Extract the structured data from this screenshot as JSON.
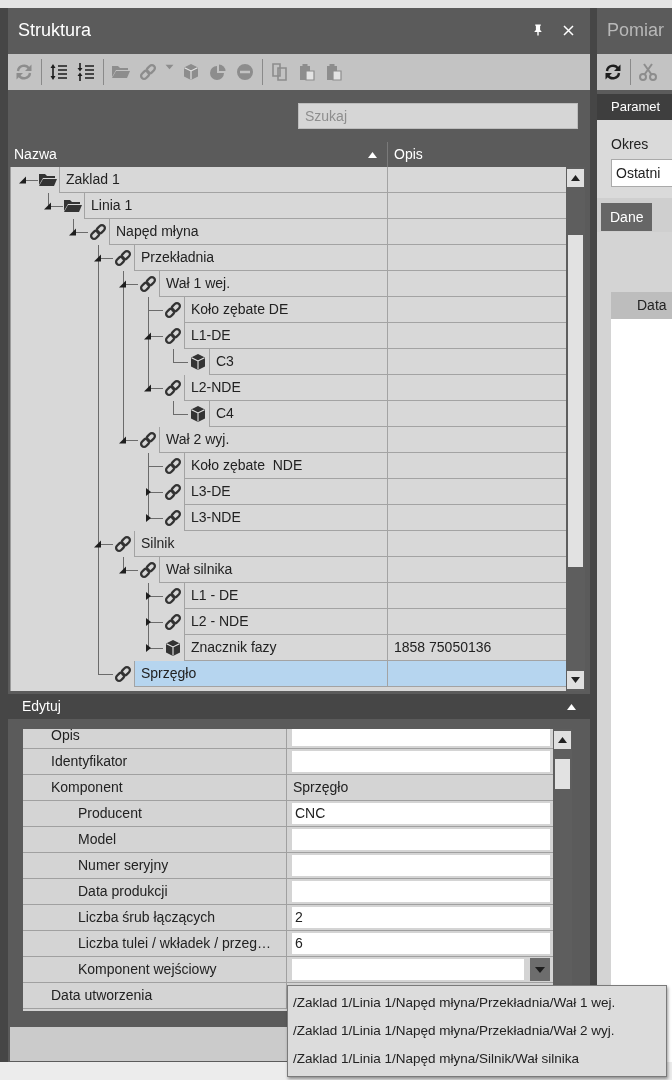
{
  "panel": {
    "title": "Struktura"
  },
  "toolbar": [
    {
      "kind": "refresh",
      "disabled": true
    },
    {
      "kind": "separator"
    },
    {
      "kind": "expand-all",
      "disabled": false
    },
    {
      "kind": "collapse-all",
      "disabled": false
    },
    {
      "kind": "separator"
    },
    {
      "kind": "folder",
      "disabled": true
    },
    {
      "kind": "link",
      "disabled": true
    },
    {
      "kind": "caret",
      "disabled": true
    },
    {
      "kind": "cube",
      "disabled": true
    },
    {
      "kind": "chart",
      "disabled": true
    },
    {
      "kind": "remove",
      "disabled": true
    },
    {
      "kind": "separator"
    },
    {
      "kind": "copy",
      "disabled": true
    },
    {
      "kind": "paste",
      "disabled": true
    },
    {
      "kind": "paste",
      "disabled": true
    }
  ],
  "search": {
    "placeholder": "Szukaj"
  },
  "tree": {
    "columns": [
      {
        "label": "Nazwa",
        "sorted": true
      },
      {
        "label": "Opis",
        "sorted": false
      }
    ],
    "items": [
      {
        "name": "Zaklad 1",
        "kind": "folder",
        "expanded": true,
        "selected": false,
        "children": [
          {
            "name": "Linia 1",
            "kind": "folder",
            "expanded": true,
            "selected": false,
            "children": [
              {
                "name": "Napęd młyna",
                "kind": "link",
                "expanded": true,
                "selected": false,
                "children": [
                  {
                    "name": "Przekładnia",
                    "kind": "link",
                    "expanded": true,
                    "selected": false,
                    "children": [
                      {
                        "name": "Wał 1 wej.",
                        "kind": "link",
                        "expanded": true,
                        "selected": false,
                        "children": [
                          {
                            "name": "Koło zębate DE",
                            "kind": "link",
                            "selected": false
                          },
                          {
                            "name": "L1-DE",
                            "kind": "link",
                            "expanded": true,
                            "selected": false,
                            "children": [
                              {
                                "name": "C3",
                                "kind": "cube",
                                "selected": false
                              }
                            ]
                          },
                          {
                            "name": "L2-NDE",
                            "kind": "link",
                            "expanded": true,
                            "selected": false,
                            "children": [
                              {
                                "name": "C4",
                                "kind": "cube",
                                "selected": false
                              }
                            ]
                          }
                        ]
                      },
                      {
                        "name": "Wał 2 wyj.",
                        "kind": "link",
                        "expanded": true,
                        "selected": false,
                        "children": [
                          {
                            "name": "Koło zębate  NDE",
                            "kind": "link",
                            "selected": false
                          },
                          {
                            "name": "L3-DE",
                            "kind": "link",
                            "expanded": false,
                            "selected": false
                          },
                          {
                            "name": "L3-NDE",
                            "kind": "link",
                            "expanded": false,
                            "selected": false
                          }
                        ]
                      }
                    ]
                  },
                  {
                    "name": "Silnik",
                    "kind": "link",
                    "expanded": true,
                    "selected": false,
                    "children": [
                      {
                        "name": "Wał silnika",
                        "kind": "link",
                        "expanded": true,
                        "selected": false,
                        "children": [
                          {
                            "name": "L1 - DE",
                            "kind": "link",
                            "expanded": false,
                            "selected": false
                          },
                          {
                            "name": "L2 - NDE",
                            "kind": "link",
                            "expanded": false,
                            "selected": false
                          },
                          {
                            "name": "Znacznik fazy",
                            "kind": "cube",
                            "expanded": false,
                            "selected": false,
                            "opis": "1858 75050136"
                          }
                        ]
                      }
                    ]
                  },
                  {
                    "name": "Sprzęgło",
                    "kind": "link",
                    "selected": true
                  }
                ]
              }
            ]
          }
        ]
      }
    ]
  },
  "editor": {
    "title": "Edytuj",
    "properties": [
      {
        "label": "Opis",
        "kind": "input"
      },
      {
        "label": "Identyfikator",
        "kind": "input"
      },
      {
        "label": "Komponent",
        "kind": "text",
        "value": "Sprzęgło",
        "children": [
          {
            "label": "Producent",
            "kind": "input",
            "value": "CNC"
          },
          {
            "label": "Model",
            "kind": "input"
          },
          {
            "label": "Numer seryjny",
            "kind": "input"
          },
          {
            "label": "Data produkcji",
            "kind": "input"
          },
          {
            "label": "Liczba śrub łączących",
            "kind": "input",
            "value": "2"
          },
          {
            "label": "Liczba tulei / wkładek / przeg…",
            "kind": "input",
            "value": "6"
          },
          {
            "label": "Komponent wejściowy",
            "kind": "combo",
            "expanded": true,
            "options": [
              "/Zaklad 1/Linia 1/Napęd młyna/Przekładnia/Wał 1 wej.",
              "/Zaklad 1/Linia 1/Napęd młyna/Przekładnia/Wał 2 wyj.",
              "/Zaklad 1/Linia 1/Napęd młyna/Silnik/Wał silnika"
            ]
          }
        ]
      },
      {
        "label": "Data utworzenia",
        "kind": "text"
      }
    ]
  },
  "right_panel": {
    "title": "Pomiar",
    "toolbar": [
      {
        "kind": "refresh",
        "disabled": false
      },
      {
        "kind": "separator"
      },
      {
        "kind": "scissors",
        "disabled": true
      }
    ],
    "tab": "Paramet",
    "period_label": "Okres",
    "period_value": "Ostatni",
    "data_tab": "Dane",
    "column": "Data"
  }
}
